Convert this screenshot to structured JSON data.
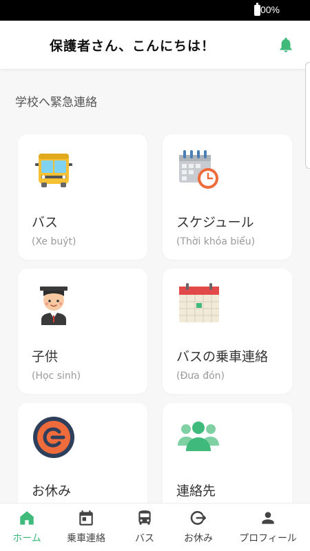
{
  "status_bar": {
    "battery": "100%"
  },
  "header": {
    "greeting": "保護者さん、こんにちは！",
    "bell_icon": "bell-icon"
  },
  "section": {
    "title": "学校へ緊急連絡"
  },
  "cards": [
    {
      "title": "バス",
      "subtitle": "(Xe buýt)",
      "icon": "school-bus-icon"
    },
    {
      "title": "スケジュール",
      "subtitle": "(Thời khóa biểu)",
      "icon": "calendar-clock-icon"
    },
    {
      "title": "子供",
      "subtitle": "(Học sinh)",
      "icon": "student-icon"
    },
    {
      "title": "バスの乗車連絡",
      "subtitle": "(Đưa đón)",
      "icon": "calendar-icon"
    },
    {
      "title": "お休み",
      "subtitle": "",
      "icon": "leave-icon"
    },
    {
      "title": "連絡先",
      "subtitle": "",
      "icon": "people-icon"
    }
  ],
  "bottom_nav": [
    {
      "label": "ホーム",
      "icon": "home-icon",
      "active": true
    },
    {
      "label": "乗車連絡",
      "icon": "calendar-icon",
      "active": false
    },
    {
      "label": "バス",
      "icon": "bus-icon",
      "active": false
    },
    {
      "label": "お休み",
      "icon": "exit-icon",
      "active": false
    },
    {
      "label": "プロフィール",
      "icon": "person-icon",
      "active": false
    }
  ],
  "colors": {
    "accent": "#3fba7a",
    "inactive": "#444444",
    "background": "#f7f7f7"
  }
}
